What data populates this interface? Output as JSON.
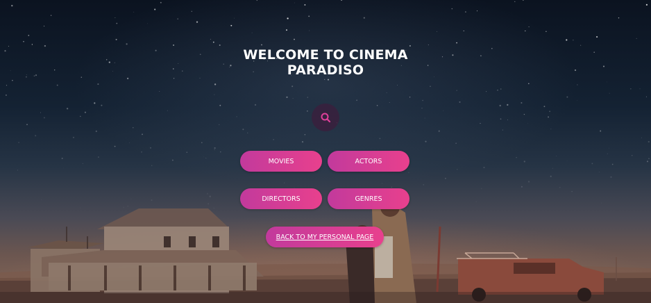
{
  "hero": {
    "title_line1": "WELCOME TO CINEMA",
    "title_line2": "PARADISO"
  },
  "search": {
    "icon": "search-icon"
  },
  "nav": {
    "movies": "MOVIES",
    "actors": "ACTORS",
    "directors": "DIRECTORS",
    "genres": "GENRES",
    "back": "BACK TO MY PERSONAL PAGE"
  },
  "colors": {
    "accent_start": "#c23a9c",
    "accent_end": "#e8408d",
    "search_icon": "#e0409a",
    "search_bg": "#3c1e3c",
    "text": "#ffffff"
  }
}
